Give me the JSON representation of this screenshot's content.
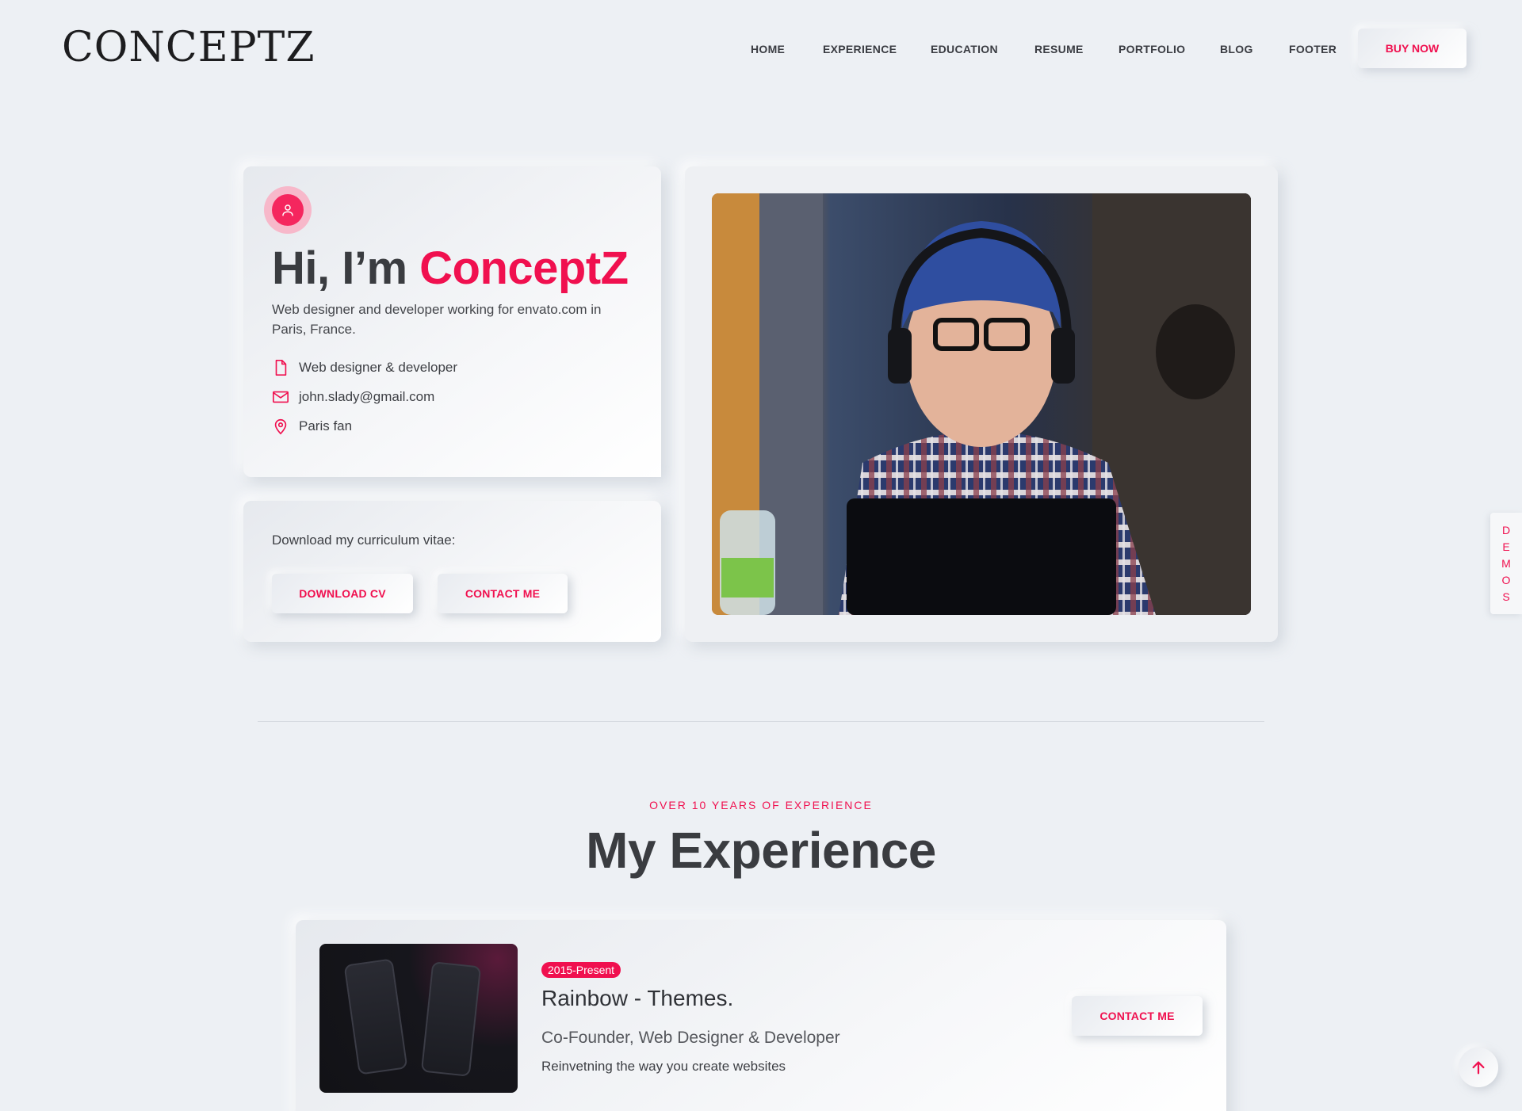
{
  "header": {
    "logo": "CONCEPTZ",
    "nav": [
      "HOME",
      "EXPERIENCE",
      "EDUCATION",
      "RESUME",
      "PORTFOLIO",
      "BLOG",
      "FOOTER"
    ],
    "buy_label": "BUY NOW"
  },
  "intro": {
    "greeting": "Hi, I’m ",
    "name": "ConceptZ",
    "description": "Web designer and developer working for envato.com in Paris, France.",
    "info": [
      {
        "icon": "file-icon",
        "text": "Web designer & developer"
      },
      {
        "icon": "mail-icon",
        "text": "john.slady@gmail.com"
      },
      {
        "icon": "location-pin-icon",
        "text": "Paris fan"
      }
    ]
  },
  "cv": {
    "label": "Download my curriculum vitae:",
    "download_label": "DOWNLOAD CV",
    "contact_label": "CONTACT ME"
  },
  "experience": {
    "kicker": "OVER 10 YEARS OF EXPERIENCE",
    "title": "My Experience",
    "items": [
      {
        "years": "2015-Present",
        "company": "Rainbow - Themes.",
        "role": "Co-Founder, Web Designer & Developer",
        "description": "Reinvetning the way you create websites",
        "contact_label": "CONTACT ME"
      }
    ]
  },
  "demos_label": [
    "D",
    "E",
    "M",
    "O",
    "S"
  ],
  "colors": {
    "accent": "#f0104f",
    "background": "#edf0f4",
    "text": "#3a3c40"
  }
}
